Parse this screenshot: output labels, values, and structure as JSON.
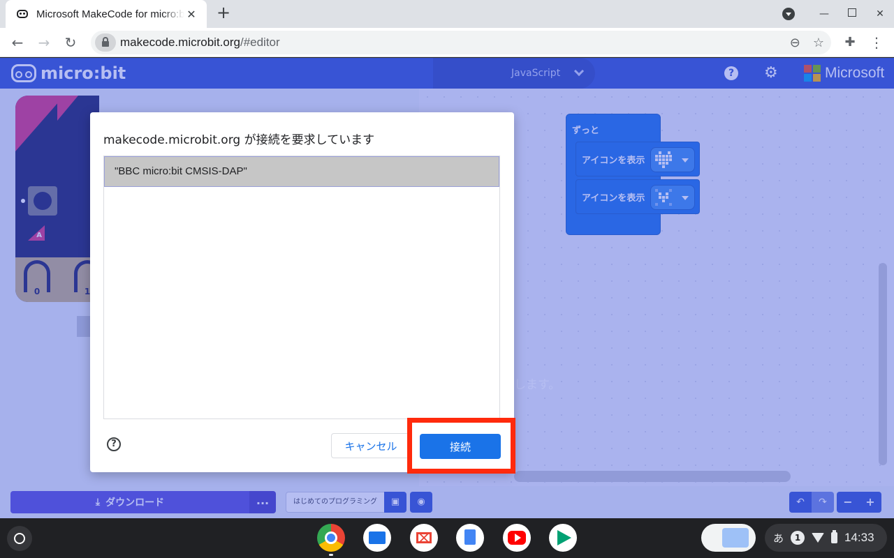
{
  "browser": {
    "tab_title": "Microsoft MakeCode for micro:bit",
    "tab_close": "✕",
    "new_tab": "+",
    "url_host": "makecode.microbit.org",
    "url_path": "/#editor"
  },
  "makecode": {
    "logo_text": "micro:bit",
    "editor_mode": "JavaScript",
    "brand": "Microsoft",
    "brand_colors": [
      "#f25022",
      "#7fba00",
      "#00a4ef",
      "#ffb900"
    ],
    "simulator_pins": [
      "0",
      "1"
    ],
    "simulator_button_label": "A",
    "workspace_hint": "します。",
    "blocks": {
      "forever": "ずっと",
      "show_icon_1": "アイコンを表示",
      "show_icon_2": "アイコンを表示"
    },
    "download_label": "ダウンロード",
    "more_label": "...",
    "project_name": "はじめてのプログラミング"
  },
  "dialog": {
    "title": "makecode.microbit.org が接続を要求しています",
    "devices": [
      "\"BBC micro:bit CMSIS-DAP\""
    ],
    "help": "?",
    "cancel_label": "キャンセル",
    "connect_label": "接続",
    "highlight_color": "#ff2a0c"
  },
  "shelf": {
    "ime": "あ",
    "notifications": "1",
    "time": "14:33"
  }
}
